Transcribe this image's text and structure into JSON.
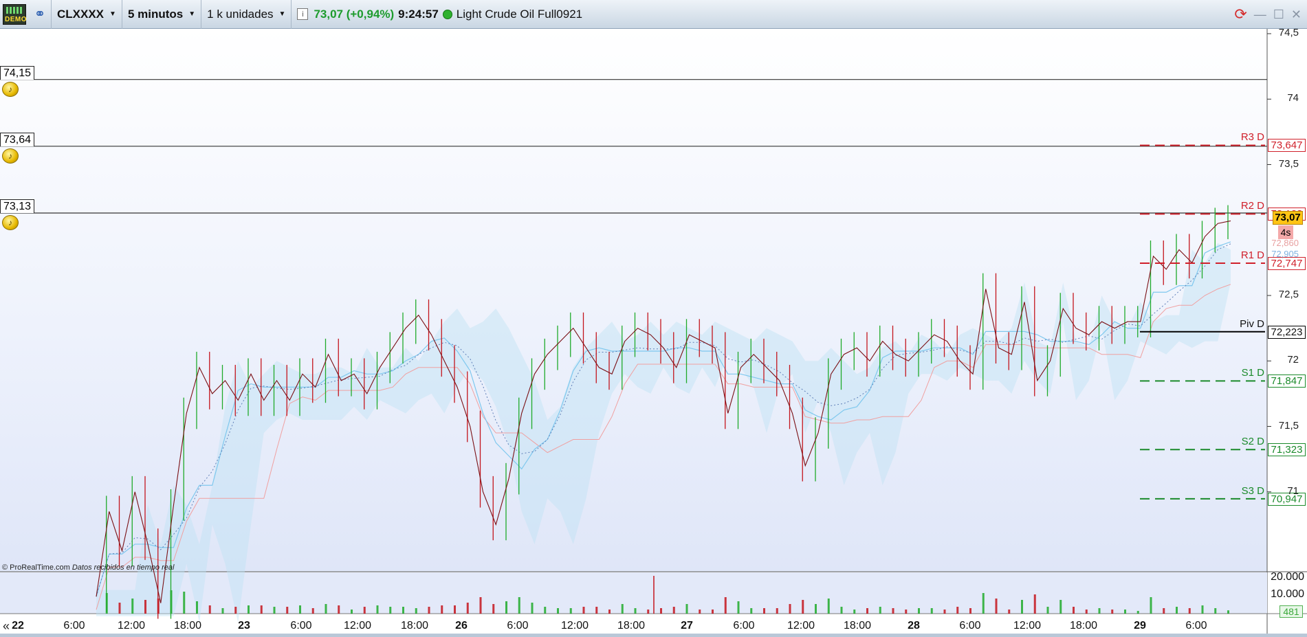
{
  "toolbar": {
    "demo_badge": "DEMO",
    "instrument": "CLXXXX",
    "timeframe": "5 minutos",
    "units": "1 k unidades",
    "price_change": "73,07 (+0,94%)",
    "time": "9:24:57",
    "title": "Light Crude Oil Full0921",
    "icons": [
      "demo-icon",
      "link-icon",
      "info-icon",
      "live-status-icon",
      "refresh-icon",
      "minimize-icon",
      "maximize-icon",
      "close-icon"
    ]
  },
  "alerts": [
    {
      "label": "74,15",
      "price": 74.15
    },
    {
      "label": "73,64",
      "price": 73.64
    },
    {
      "label": "73,13",
      "price": 73.13
    }
  ],
  "pivots": [
    {
      "tag": "R3 D",
      "value": "73,647",
      "price": 73.647,
      "color": "#d0202a",
      "style": "dashed"
    },
    {
      "tag": "R2 D",
      "value": "73,123",
      "price": 73.123,
      "color": "#d0202a",
      "style": "dashed"
    },
    {
      "tag": "R1 D",
      "value": "72,747",
      "price": 72.747,
      "color": "#d0202a",
      "style": "dashed"
    },
    {
      "tag": "Piv D",
      "value": "72,223",
      "price": 72.223,
      "color": "#000000",
      "style": "solid"
    },
    {
      "tag": "S1 D",
      "value": "71,847",
      "price": 71.847,
      "color": "#1a8a2a",
      "style": "dashed"
    },
    {
      "tag": "S2 D",
      "value": "71,323",
      "price": 71.323,
      "color": "#1a8a2a",
      "style": "dashed"
    },
    {
      "tag": "S3 D",
      "value": "70,947",
      "price": 70.947,
      "color": "#1a8a2a",
      "style": "dashed"
    }
  ],
  "price_axis": {
    "ticks": [
      {
        "label": "74,5",
        "price": 74.5
      },
      {
        "label": "74",
        "price": 74.0
      },
      {
        "label": "73,5",
        "price": 73.5
      },
      {
        "label": "72,5",
        "price": 72.5
      },
      {
        "label": "72",
        "price": 72.0
      },
      {
        "label": "71,5",
        "price": 71.5
      },
      {
        "label": "71",
        "price": 71.0
      }
    ],
    "current_price": "73,07",
    "countdown": "4s",
    "other_values": [
      "72,860",
      "72,905"
    ]
  },
  "time_axis": [
    {
      "label": "22",
      "bold": true
    },
    {
      "label": "6:00",
      "bold": false
    },
    {
      "label": "12:00",
      "bold": false
    },
    {
      "label": "18:00",
      "bold": false
    },
    {
      "label": "23",
      "bold": true
    },
    {
      "label": "6:00",
      "bold": false
    },
    {
      "label": "12:00",
      "bold": false
    },
    {
      "label": "18:00",
      "bold": false
    },
    {
      "label": "26",
      "bold": true
    },
    {
      "label": "6:00",
      "bold": false
    },
    {
      "label": "12:00",
      "bold": false
    },
    {
      "label": "18:00",
      "bold": false
    },
    {
      "label": "27",
      "bold": true
    },
    {
      "label": "6:00",
      "bold": false
    },
    {
      "label": "12:00",
      "bold": false
    },
    {
      "label": "18:00",
      "bold": false
    },
    {
      "label": "28",
      "bold": true
    },
    {
      "label": "6:00",
      "bold": false
    },
    {
      "label": "12:00",
      "bold": false
    },
    {
      "label": "18:00",
      "bold": false
    },
    {
      "label": "29",
      "bold": true
    },
    {
      "label": "6:00",
      "bold": false
    }
  ],
  "volume_axis": {
    "labels": [
      "20.000",
      "10.000"
    ],
    "current_volume": "481"
  },
  "watermark": {
    "brand": "© ProRealTime.com",
    "note": "Datos recibidos en tiempo real"
  },
  "nav": {
    "back_label": "«"
  },
  "colors": {
    "up": "#1faa2a",
    "down": "#c4141c",
    "price_line": "#7a0f14",
    "cloud": "#bfe3f5",
    "tenkan": "#7fc8ee",
    "kijun": "#f0a0a0",
    "current": "#ffc414"
  },
  "chart_data": {
    "type": "line",
    "title": "",
    "ylim": [
      70.25,
      74.55
    ],
    "series": [
      {
        "values": [
          70.2,
          70.85,
          70.55,
          71.0,
          70.6,
          70.15,
          70.9,
          71.6,
          71.95,
          71.75,
          71.85,
          71.7,
          71.9,
          71.7,
          71.85,
          71.7,
          71.9,
          71.8,
          72.05,
          71.85,
          71.9,
          71.75,
          71.95,
          72.1,
          72.25,
          72.35,
          72.2,
          72.0,
          71.8,
          71.5,
          71.0,
          70.75,
          71.1,
          71.6,
          71.9,
          72.05,
          72.15,
          72.25,
          72.1,
          71.95,
          71.9,
          72.15,
          72.25,
          72.2,
          72.1,
          71.95,
          72.2,
          72.15,
          72.1,
          71.6,
          71.95,
          72.05,
          71.95,
          71.85,
          71.6,
          71.2,
          71.45,
          71.9,
          72.05,
          72.1,
          72.0,
          72.15,
          72.05,
          72.0,
          72.1,
          72.2,
          72.15,
          72.0,
          71.9,
          72.55,
          72.1,
          72.05,
          72.45,
          71.85,
          72.0,
          72.4,
          72.25,
          72.2,
          72.3,
          72.25,
          72.3,
          72.3,
          72.8,
          72.7,
          72.85,
          72.75,
          72.95,
          73.05,
          73.07
        ]
      }
    ],
    "price_axis_ticks": [
      74.5,
      74.0,
      73.5,
      72.5,
      72.0,
      71.5,
      71.0
    ],
    "volume_ylim": [
      0,
      20000
    ],
    "last_volume": 481
  }
}
